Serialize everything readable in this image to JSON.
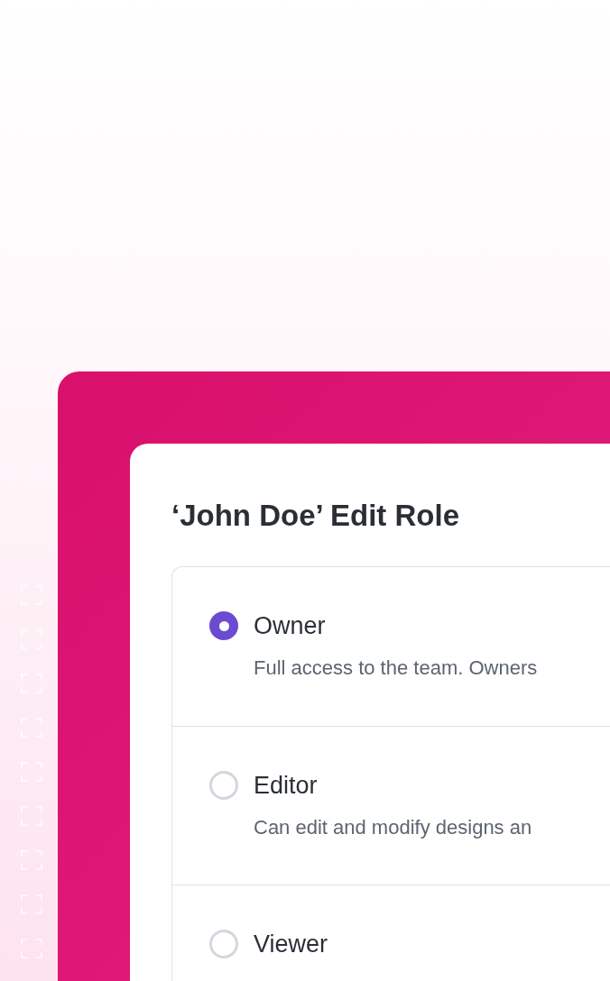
{
  "dialog": {
    "title": "‘John Doe’ Edit Role",
    "roles": [
      {
        "label": "Owner",
        "description": "Full access to the team. Owners",
        "selected": true
      },
      {
        "label": "Editor",
        "description": "Can edit and modify designs an",
        "selected": false
      },
      {
        "label": "Viewer",
        "selected": false
      }
    ]
  }
}
